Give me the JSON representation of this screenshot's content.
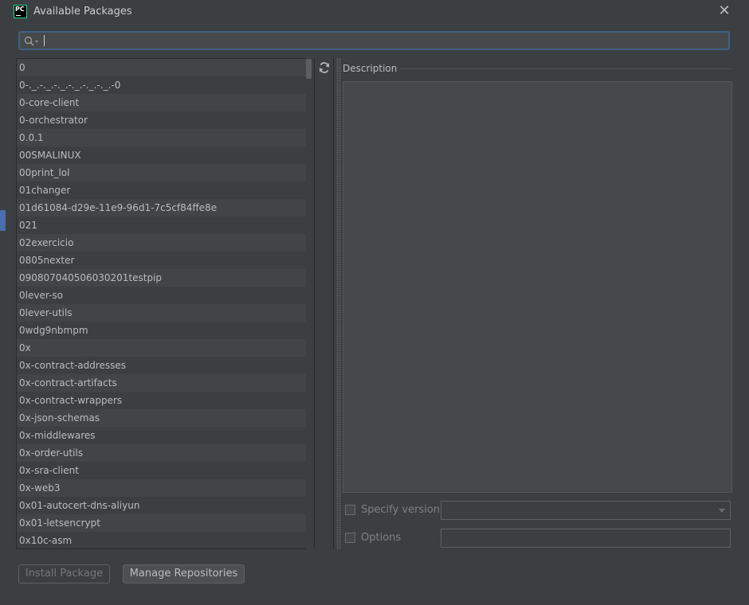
{
  "dialog": {
    "title": "Available Packages",
    "app_icon_text": "PC",
    "close_glyph": "✕"
  },
  "search": {
    "value": "",
    "icon": "search-icon"
  },
  "packages": [
    "0",
    "0-._.-._.-._.-._.-._.-._.-0",
    "0-core-client",
    "0-orchestrator",
    "0.0.1",
    "00SMALINUX",
    "00print_lol",
    "01changer",
    "01d61084-d29e-11e9-96d1-7c5cf84ffe8e",
    "021",
    "02exercicio",
    "0805nexter",
    "090807040506030201testpip",
    "0lever-so",
    "0lever-utils",
    "0wdg9nbmpm",
    "0x",
    "0x-contract-addresses",
    "0x-contract-artifacts",
    "0x-contract-wrappers",
    "0x-json-schemas",
    "0x-middlewares",
    "0x-order-utils",
    "0x-sra-client",
    "0x-web3",
    "0x01-autocert-dns-aliyun",
    "0x01-letsencrypt",
    "0x10c-asm"
  ],
  "description": {
    "label": "Description",
    "text": ""
  },
  "specify_version": {
    "label": "Specify version",
    "checked": false,
    "selected_value": ""
  },
  "options": {
    "label": "Options",
    "checked": false,
    "value": ""
  },
  "buttons": {
    "install": "Install Package",
    "manage": "Manage Repositories"
  },
  "colors": {
    "dialog_bg": "#3c3f41",
    "focus_border": "#3d6185",
    "row_alt": "#414547"
  }
}
